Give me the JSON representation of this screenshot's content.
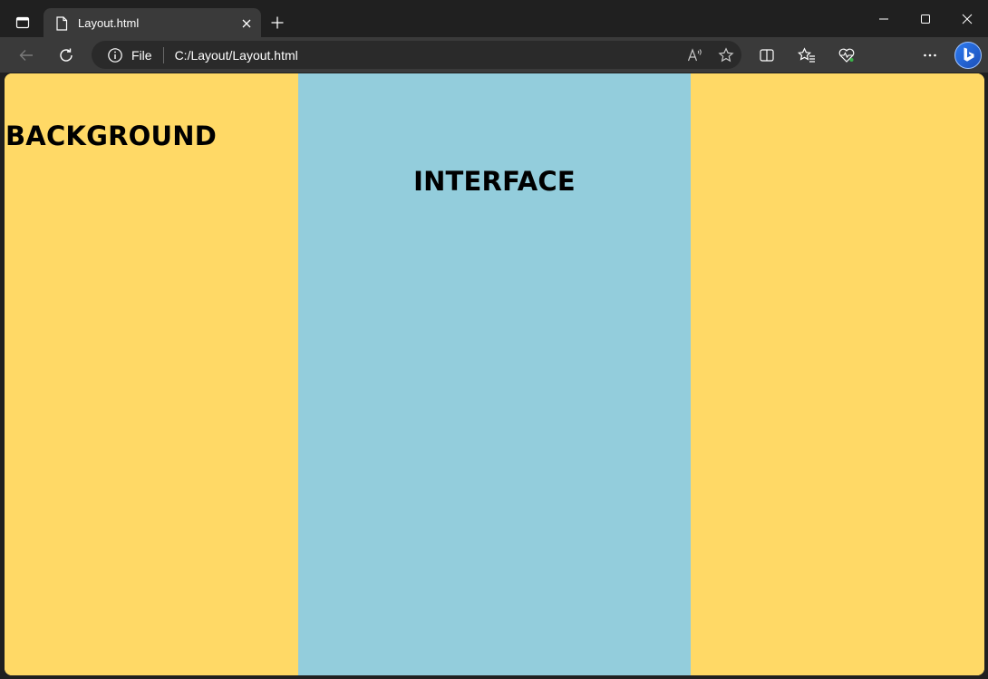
{
  "browser": {
    "tab": {
      "title": "Layout.html"
    },
    "address_bar": {
      "scheme": "File",
      "url": "C:/Layout/Layout.html"
    }
  },
  "page": {
    "left_heading": "BACKGROUND",
    "center_heading": "INTERFACE"
  },
  "colors": {
    "side_columns": "#FFD966",
    "center_column": "#93CDDC",
    "chrome_dark": "#202020",
    "chrome_toolbar": "#3a3a3a"
  },
  "icons": [
    "tab-actions-icon",
    "page-icon",
    "close-icon",
    "plus-icon",
    "minimize-icon",
    "maximize-icon",
    "window-close-icon",
    "back-icon",
    "refresh-icon",
    "info-icon",
    "read-aloud-icon",
    "favorite-star-icon",
    "split-screen-icon",
    "favorites-icon",
    "browser-essentials-icon",
    "more-icon",
    "copilot-icon"
  ]
}
